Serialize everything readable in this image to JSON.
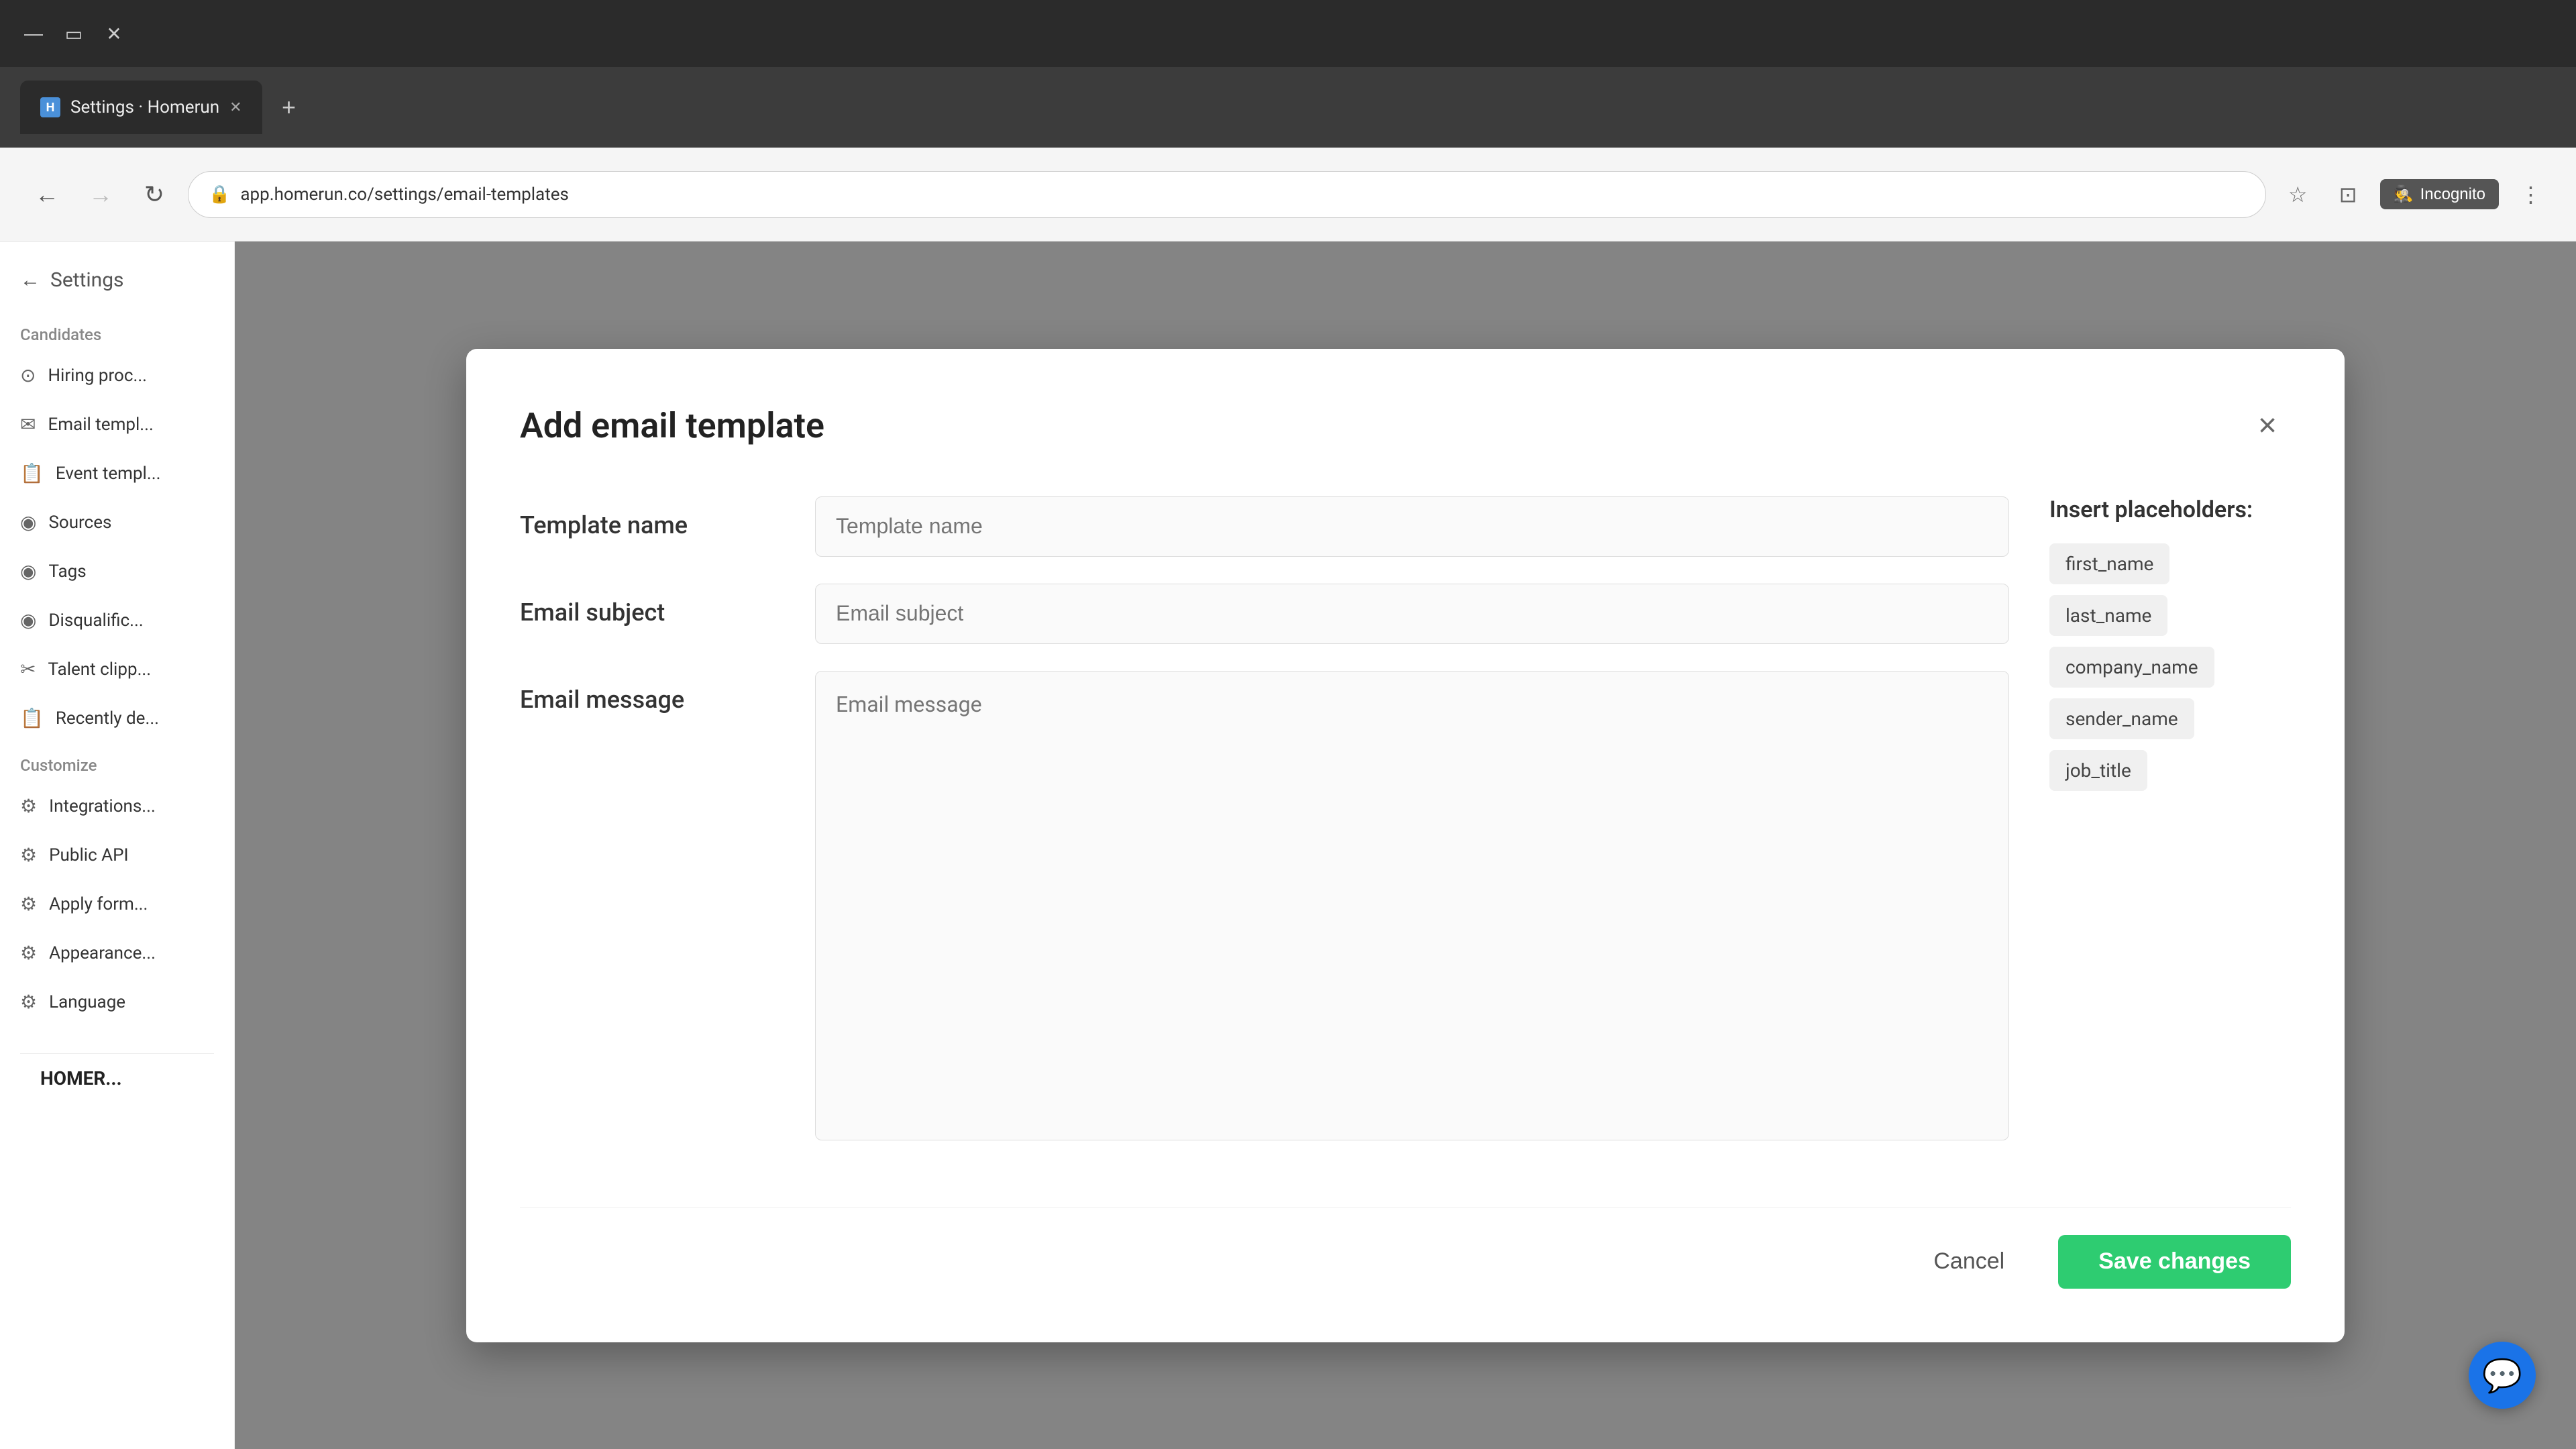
{
  "browser": {
    "tab_title": "Settings · Homerun",
    "tab_favicon": "H",
    "address": "app.homerun.co/settings/email-templates",
    "incognito_label": "Incognito"
  },
  "sidebar": {
    "back_label": "Settings",
    "sections": [
      {
        "label": "Candidates",
        "items": [
          {
            "id": "hiring-process",
            "icon": "⊙",
            "label": "Hiring proc..."
          },
          {
            "id": "email-templates",
            "icon": "✉",
            "label": "Email templ..."
          },
          {
            "id": "event-templates",
            "icon": "📋",
            "label": "Event templ..."
          },
          {
            "id": "sources",
            "icon": "◉",
            "label": "Sources"
          },
          {
            "id": "tags",
            "icon": "◉",
            "label": "Tags"
          },
          {
            "id": "disqualification",
            "icon": "◉",
            "label": "Disqualific..."
          },
          {
            "id": "talent-clips",
            "icon": "✂",
            "label": "Talent clipp..."
          },
          {
            "id": "recently-deleted",
            "icon": "📋",
            "label": "Recently de..."
          }
        ]
      },
      {
        "label": "Customize",
        "items": [
          {
            "id": "integrations",
            "icon": "⚙",
            "label": "Integrations..."
          },
          {
            "id": "public-api",
            "icon": "⚙",
            "label": "Public API"
          },
          {
            "id": "apply-form",
            "icon": "⚙",
            "label": "Apply form..."
          },
          {
            "id": "appearance",
            "icon": "⚙",
            "label": "Appearance..."
          },
          {
            "id": "language",
            "icon": "⚙",
            "label": "Language"
          }
        ]
      }
    ],
    "logo": "HOMER..."
  },
  "modal": {
    "title": "Add email template",
    "close_label": "×",
    "form": {
      "template_name_label": "Template name",
      "template_name_placeholder": "Template name",
      "email_subject_label": "Email subject",
      "email_subject_placeholder": "Email subject",
      "email_message_label": "Email message",
      "email_message_placeholder": "Email message"
    },
    "placeholders": {
      "title": "Insert placeholders:",
      "chips": [
        "first_name",
        "last_name",
        "company_name",
        "sender_name",
        "job_title"
      ]
    },
    "footer": {
      "cancel_label": "Cancel",
      "save_label": "Save changes"
    }
  }
}
